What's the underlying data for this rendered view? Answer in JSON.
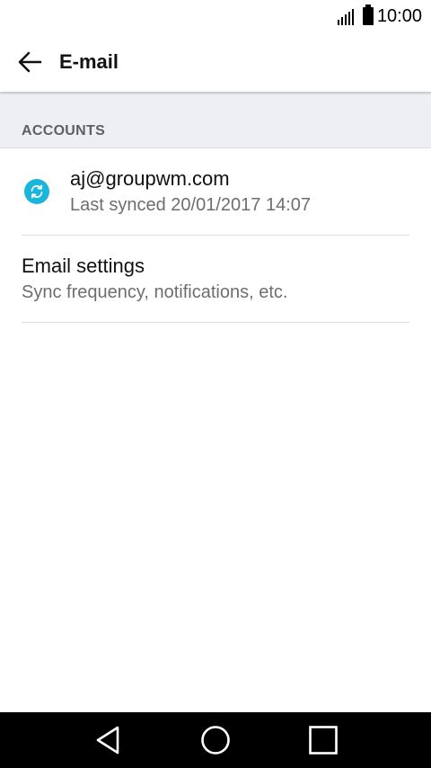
{
  "status_bar": {
    "time": "10:00",
    "signal_icon": "signal-icon",
    "battery_icon": "battery-icon"
  },
  "app_bar": {
    "title": "E-mail",
    "back_icon": "arrow-left-icon"
  },
  "accounts_section": {
    "header": "ACCOUNTS",
    "items": [
      {
        "icon": "sync-icon",
        "title": "aj@groupwm.com",
        "subtitle": "Last synced 20/01/2017 14:07",
        "icon_color": "#19b5dc"
      }
    ]
  },
  "settings_item": {
    "title": "Email settings",
    "subtitle": "Sync frequency, notifications, etc."
  },
  "nav_bar": {
    "back": "nav-back-icon",
    "home": "nav-home-icon",
    "recents": "nav-recents-icon"
  }
}
